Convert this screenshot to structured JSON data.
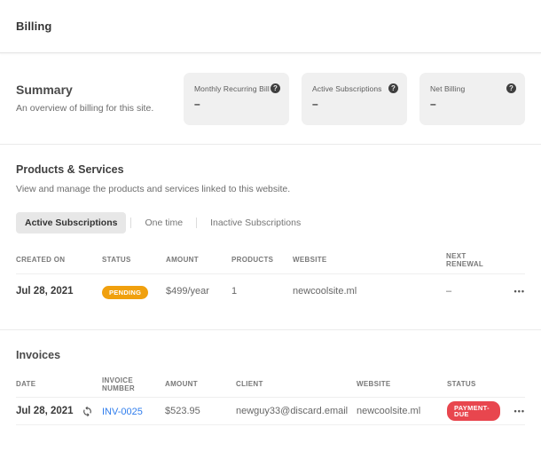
{
  "page": {
    "title": "Billing"
  },
  "summary": {
    "heading": "Summary",
    "subtitle": "An overview of billing for this site.",
    "cards": [
      {
        "label": "Monthly Recurring Bill",
        "value": "–"
      },
      {
        "label": "Active Subscriptions",
        "value": "–"
      },
      {
        "label": "Net Billing",
        "value": "–"
      }
    ]
  },
  "products": {
    "heading": "Products & Services",
    "subtitle": "View and manage the products and services linked to this website.",
    "tabs": [
      {
        "label": "Active Subscriptions"
      },
      {
        "label": "One time"
      },
      {
        "label": "Inactive Subscriptions"
      }
    ],
    "table": {
      "headers": [
        "Created On",
        "Status",
        "Amount",
        "Products",
        "Website",
        "Next Renewal"
      ],
      "rows": [
        {
          "created_on": "Jul 28, 2021",
          "status": "PENDING",
          "amount": "$499/year",
          "products": "1",
          "website": "newcoolsite.ml",
          "next_renewal": "–"
        }
      ]
    }
  },
  "invoices": {
    "heading": "Invoices",
    "table": {
      "headers": [
        "Date",
        "Invoice Number",
        "Amount",
        "Client",
        "Website",
        "Status"
      ],
      "rows": [
        {
          "date": "Jul 28, 2021",
          "invoice_number": "INV-0025",
          "amount": "$523.95",
          "client": "newguy33@discard.email",
          "website": "newcoolsite.ml",
          "status": "PAYMENT-DUE"
        }
      ]
    }
  },
  "colors": {
    "pending_badge": "#f0a00e",
    "payment_due_badge": "#e8464e",
    "invoice_link": "#2f7ded"
  },
  "icons": {
    "help_glyph": "?",
    "overflow_glyph": "•••"
  }
}
